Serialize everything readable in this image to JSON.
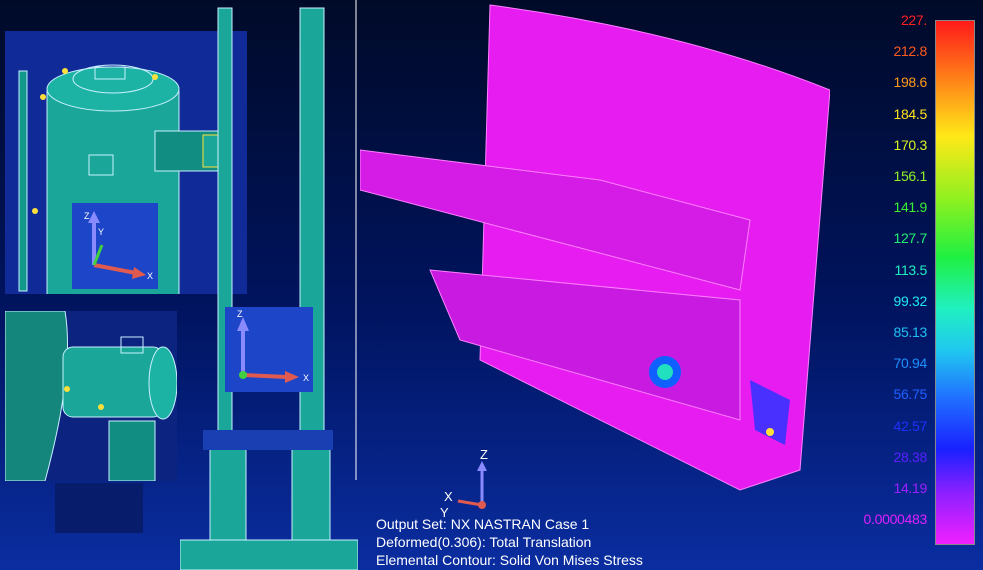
{
  "legend": {
    "labels": [
      {
        "text": "227.",
        "color": "#ff2020"
      },
      {
        "text": "212.8",
        "color": "#ff5a1e"
      },
      {
        "text": "198.6",
        "color": "#ff9a1a"
      },
      {
        "text": "184.5",
        "color": "#ffe21a"
      },
      {
        "text": "170.3",
        "color": "#d8f020"
      },
      {
        "text": "156.1",
        "color": "#8ef028"
      },
      {
        "text": "141.9",
        "color": "#38f030"
      },
      {
        "text": "127.7",
        "color": "#20f070"
      },
      {
        "text": "113.5",
        "color": "#20f0c0"
      },
      {
        "text": "99.32",
        "color": "#20e8f0"
      },
      {
        "text": "85.13",
        "color": "#20c0f0"
      },
      {
        "text": "70.94",
        "color": "#2090ff"
      },
      {
        "text": "56.75",
        "color": "#2060ff"
      },
      {
        "text": "42.57",
        "color": "#2030ff"
      },
      {
        "text": "28.38",
        "color": "#5a20ff"
      },
      {
        "text": "14.19",
        "color": "#a020ff"
      },
      {
        "text": "0.0000483",
        "color": "#e020ff"
      }
    ]
  },
  "info": {
    "line1": "Output Set: NX NASTRAN Case 1",
    "line2": "Deformed(0.306): Total Translation",
    "line3": "Elemental Contour: Solid Von Mises Stress"
  },
  "triads": {
    "z": "Z",
    "y": "Y",
    "x": "X"
  }
}
